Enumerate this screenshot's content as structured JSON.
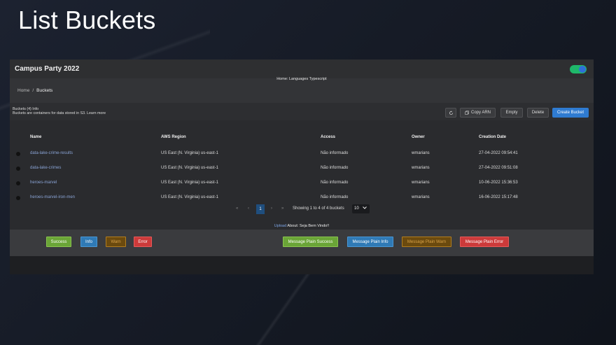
{
  "slide": {
    "title": "List Buckets"
  },
  "app": {
    "title": "Campus Party 2022",
    "home_link": "Home: Languages Typescript",
    "breadcrumb": {
      "home": "Home",
      "separator": "/",
      "current": "Buckets"
    },
    "header": {
      "title": "Buckets (4) Info",
      "description": "Buckets are containers for data stored in S3. Learn more"
    },
    "toolbar": {
      "refresh_icon": "refresh-icon",
      "copy_icon": "copy-icon",
      "copy_arn": "Copy ARN",
      "empty": "Empty",
      "delete": "Delete",
      "create": "Create Bucket"
    },
    "table": {
      "headers": {
        "name": "Name",
        "region": "AWS Region",
        "access": "Access",
        "owner": "Owner",
        "date": "Creation Date"
      },
      "rows": [
        {
          "name": "data-lake-crime-results",
          "region": "US East (N. Virginia) us-east-1",
          "access": "Não informado",
          "owner": "wmarians",
          "date": "27-04-2022 09:54:41"
        },
        {
          "name": "data-lake-crimes",
          "region": "US East (N. Virginia) us-east-1",
          "access": "Não informado",
          "owner": "wmarians",
          "date": "27-04-2022 09:51:08"
        },
        {
          "name": "heroes-marvel",
          "region": "US East (N. Virginia) us-east-1",
          "access": "Não informado",
          "owner": "wmarians",
          "date": "10-06-2022 15:36:53"
        },
        {
          "name": "heroes-marvel-iron-men",
          "region": "US East (N. Virginia) us-east-1",
          "access": "Não informado",
          "owner": "wmarians",
          "date": "16-06-2022 15:17:48"
        }
      ]
    },
    "pagination": {
      "first": "«",
      "prev": "‹",
      "current": "1",
      "next": "›",
      "last": "»",
      "info": "Showing 1 to 4 of 4 buckets",
      "page_size": "10"
    },
    "upload": {
      "link": "Upload",
      "text": " About: Seja Bem Vindo!!"
    },
    "messages": {
      "success": "Success",
      "info": "Info",
      "warn": "Warn",
      "error": "Error",
      "plain_success": "Message Plain Success",
      "plain_info": "Message Plain Info",
      "plain_warn": "Message Plain Warn",
      "plain_error": "Message Plain Error"
    }
  }
}
